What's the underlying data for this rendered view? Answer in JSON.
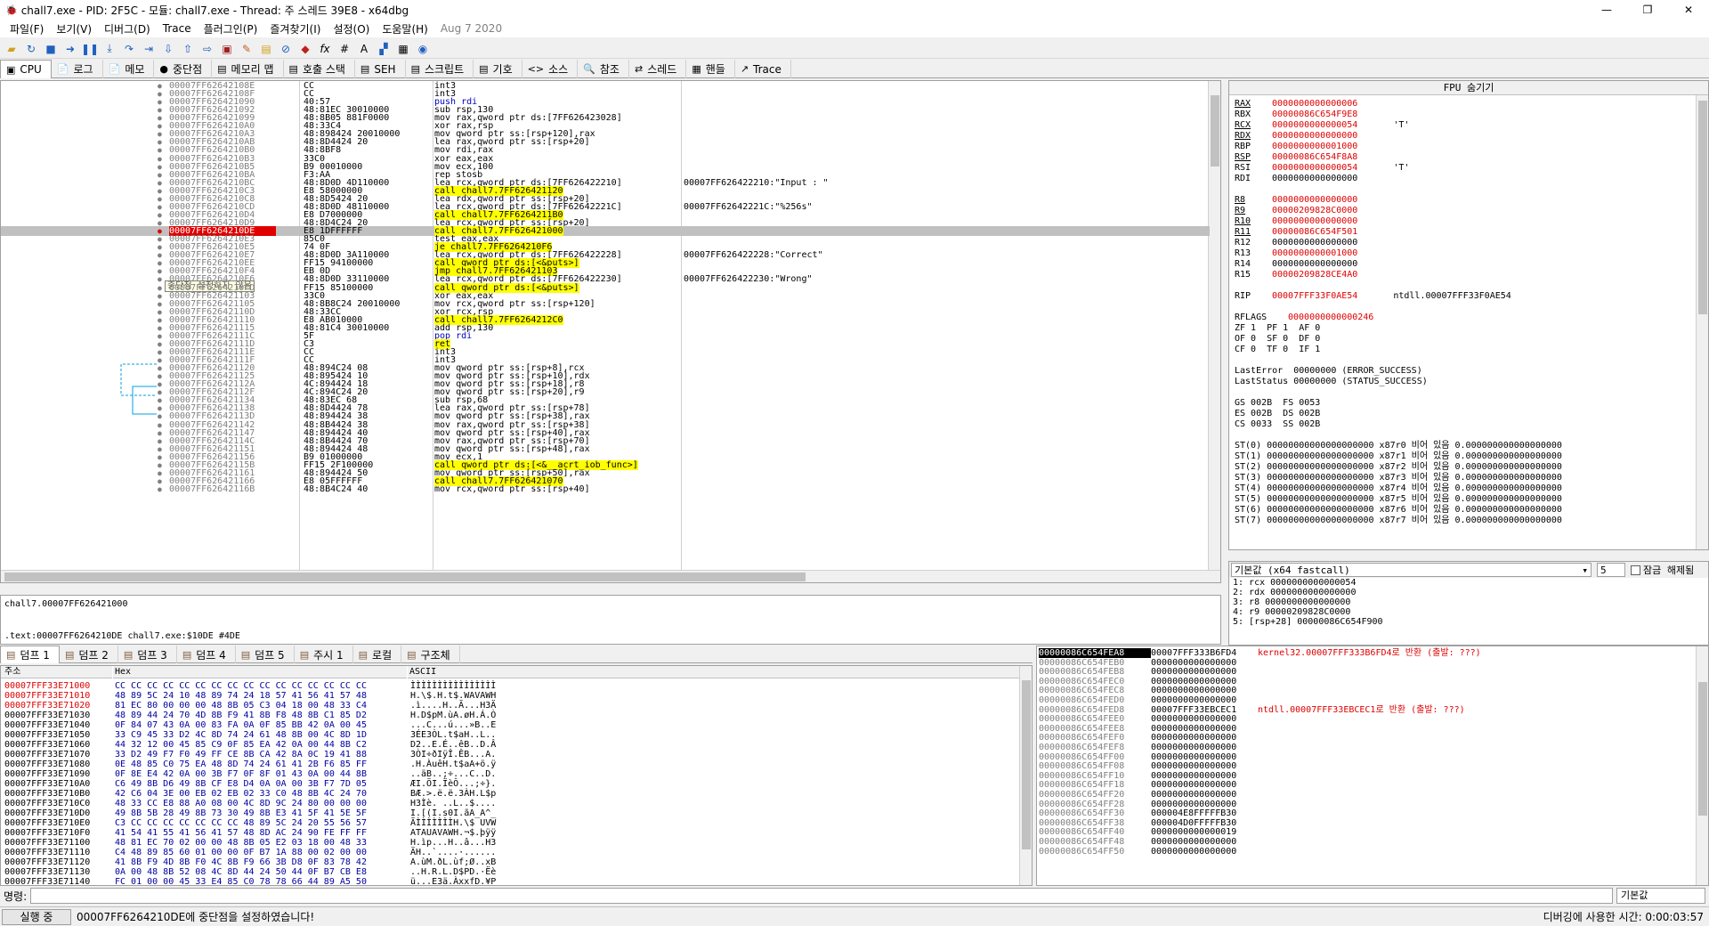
{
  "window": {
    "title": "chall7.exe - PID: 2F5C - 모듈: chall7.exe - Thread: 주 스레드 39E8 - x64dbg",
    "min": "—",
    "max": "❐",
    "close": "✕"
  },
  "menu": [
    "파일(F)",
    "보기(V)",
    "디버그(D)",
    "Trace",
    "플러그인(P)",
    "즐겨찾기(I)",
    "설정(O)",
    "도움말(H)"
  ],
  "menu_date": "Aug 7 2020",
  "tabs": [
    {
      "label": "CPU",
      "icon": "cpu-icon",
      "glyph": "▣"
    },
    {
      "label": "로그",
      "icon": "log-icon",
      "glyph": "📄"
    },
    {
      "label": "메모",
      "icon": "notes-icon",
      "glyph": "📄"
    },
    {
      "label": "중단점",
      "icon": "breakpoint-icon",
      "glyph": "●"
    },
    {
      "label": "메모리 맵",
      "icon": "memory-map-icon",
      "glyph": "▤"
    },
    {
      "label": "호출 스택",
      "icon": "call-stack-icon",
      "glyph": "▤"
    },
    {
      "label": "SEH",
      "icon": "seh-icon",
      "glyph": "▤"
    },
    {
      "label": "스크립트",
      "icon": "script-icon",
      "glyph": "▤"
    },
    {
      "label": "기호",
      "icon": "symbols-icon",
      "glyph": "▤"
    },
    {
      "label": "소스",
      "icon": "source-icon",
      "glyph": "<>"
    },
    {
      "label": "참조",
      "icon": "references-icon",
      "glyph": "🔍"
    },
    {
      "label": "스레드",
      "icon": "threads-icon",
      "glyph": "⇄"
    },
    {
      "label": "핸들",
      "icon": "handles-icon",
      "glyph": "▦"
    },
    {
      "label": "Trace",
      "icon": "trace-icon",
      "glyph": "↗"
    }
  ],
  "disasm": [
    {
      "addr": "00007FF62642108E",
      "bytes": "CC",
      "instr": "int3",
      "cmt": ""
    },
    {
      "addr": "00007FF62642108F",
      "bytes": "CC",
      "instr": "int3",
      "cmt": ""
    },
    {
      "addr": "00007FF626421090",
      "bytes": "40:57",
      "instr": "push rdi",
      "cmt": ""
    },
    {
      "addr": "00007FF626421092",
      "bytes": "48:81EC 30010000",
      "instr": "sub rsp,130",
      "cmt": ""
    },
    {
      "addr": "00007FF626421099",
      "bytes": "48:8B05 881F0000",
      "instr": "mov rax,qword ptr ds:[7FF626423028]",
      "cmt": ""
    },
    {
      "addr": "00007FF6264210A0",
      "bytes": "48:33C4",
      "instr": "xor rax,rsp",
      "cmt": ""
    },
    {
      "addr": "00007FF6264210A3",
      "bytes": "48:898424 20010000",
      "instr": "mov qword ptr ss:[rsp+120],rax",
      "cmt": ""
    },
    {
      "addr": "00007FF6264210AB",
      "bytes": "48:8D4424 20",
      "instr": "lea rax,qword ptr ss:[rsp+20]",
      "cmt": ""
    },
    {
      "addr": "00007FF6264210B0",
      "bytes": "48:8BF8",
      "instr": "mov rdi,rax",
      "cmt": ""
    },
    {
      "addr": "00007FF6264210B3",
      "bytes": "33C0",
      "instr": "xor eax,eax",
      "cmt": ""
    },
    {
      "addr": "00007FF6264210B5",
      "bytes": "B9 00010000",
      "instr": "mov ecx,100",
      "cmt": ""
    },
    {
      "addr": "00007FF6264210BA",
      "bytes": "F3:AA",
      "instr": "rep stosb",
      "cmt": ""
    },
    {
      "addr": "00007FF6264210BC",
      "bytes": "48:8D0D 4D110000",
      "instr": "lea rcx,qword ptr ds:[7FF626422210]",
      "cmt": "00007FF626422210:\"Input : \""
    },
    {
      "addr": "00007FF6264210C3",
      "bytes": "E8 58000000",
      "instr": "call chall7.7FF626421120",
      "cmt": ""
    },
    {
      "addr": "00007FF6264210C8",
      "bytes": "48:8D5424 20",
      "instr": "lea rdx,qword ptr ss:[rsp+20]",
      "cmt": ""
    },
    {
      "addr": "00007FF6264210CD",
      "bytes": "48:8D0D 48110000",
      "instr": "lea rcx,qword ptr ds:[7FF62642221C]",
      "cmt": "00007FF62642221C:\"%256s\""
    },
    {
      "addr": "00007FF6264210D4",
      "bytes": "E8 D7000000",
      "instr": "call chall7.7FF6264211B0",
      "cmt": ""
    },
    {
      "addr": "00007FF6264210D9",
      "bytes": "48:8D4C24 20",
      "instr": "lea rcx,qword ptr ss:[rsp+20]",
      "cmt": ""
    },
    {
      "addr": "00007FF6264210DE",
      "bytes": "E8 1DFFFFFF",
      "instr": "call chall7.7FF626421000",
      "cmt": ""
    },
    {
      "addr": "00007FF6264210E3",
      "bytes": "85C0",
      "instr": "test eax,eax",
      "cmt": ""
    },
    {
      "addr": "00007FF6264210E5",
      "bytes": "74 0F",
      "instr": "je chall7.7FF6264210F6",
      "cmt": ""
    },
    {
      "addr": "00007FF6264210E7",
      "bytes": "48:8D0D 3A110000",
      "instr": "lea rcx,qword ptr ds:[7FF626422228]",
      "cmt": "00007FF626422228:\"Correct\""
    },
    {
      "addr": "00007FF6264210EE",
      "bytes": "FF15 94100000",
      "instr": "call qword ptr ds:[<&puts>]",
      "cmt": ""
    },
    {
      "addr": "00007FF6264210F4",
      "bytes": "EB 0D",
      "instr": "jmp chall7.7FF626421103",
      "cmt": ""
    },
    {
      "addr": "00007FF6264210F6",
      "bytes": "48:8D0D 33110000",
      "instr": "lea rcx,qword ptr ds:[7FF626422230]",
      "cmt": "00007FF626422230:\"Wrong\""
    },
    {
      "addr": "00007FF6264210FD",
      "bytes": "FF15 85100000",
      "instr": "call qword ptr ds:[<&puts>]",
      "cmt": ""
    },
    {
      "addr": "00007FF626421103",
      "bytes": "33C0",
      "instr": "xor eax,eax",
      "cmt": ""
    },
    {
      "addr": "00007FF626421105",
      "bytes": "48:8B8C24 20010000",
      "instr": "mov rcx,qword ptr ss:[rsp+120]",
      "cmt": ""
    },
    {
      "addr": "00007FF62642110D",
      "bytes": "48:33CC",
      "instr": "xor rcx,rsp",
      "cmt": ""
    },
    {
      "addr": "00007FF626421110",
      "bytes": "E8 AB010000",
      "instr": "call chall7.7FF6264212C0",
      "cmt": ""
    },
    {
      "addr": "00007FF626421115",
      "bytes": "48:81C4 30010000",
      "instr": "add rsp,130",
      "cmt": ""
    },
    {
      "addr": "00007FF62642111C",
      "bytes": "5F",
      "instr": "pop rdi",
      "cmt": ""
    },
    {
      "addr": "00007FF62642111D",
      "bytes": "C3",
      "instr": "ret",
      "cmt": ""
    },
    {
      "addr": "00007FF62642111E",
      "bytes": "CC",
      "instr": "int3",
      "cmt": ""
    },
    {
      "addr": "00007FF62642111F",
      "bytes": "CC",
      "instr": "int3",
      "cmt": ""
    },
    {
      "addr": "00007FF626421120",
      "bytes": "48:894C24 08",
      "instr": "mov qword ptr ss:[rsp+8],rcx",
      "cmt": ""
    },
    {
      "addr": "00007FF626421125",
      "bytes": "48:895424 10",
      "instr": "mov qword ptr ss:[rsp+10],rdx",
      "cmt": ""
    },
    {
      "addr": "00007FF62642112A",
      "bytes": "4C:894424 18",
      "instr": "mov qword ptr ss:[rsp+18],r8",
      "cmt": ""
    },
    {
      "addr": "00007FF62642112F",
      "bytes": "4C:894C24 20",
      "instr": "mov qword ptr ss:[rsp+20],r9",
      "cmt": ""
    },
    {
      "addr": "00007FF626421134",
      "bytes": "48:83EC 68",
      "instr": "sub rsp,68",
      "cmt": ""
    },
    {
      "addr": "00007FF626421138",
      "bytes": "48:8D4424 78",
      "instr": "lea rax,qword ptr ss:[rsp+78]",
      "cmt": ""
    },
    {
      "addr": "00007FF62642113D",
      "bytes": "48:894424 38",
      "instr": "mov qword ptr ss:[rsp+38],rax",
      "cmt": ""
    },
    {
      "addr": "00007FF626421142",
      "bytes": "48:8B4424 38",
      "instr": "mov rax,qword ptr ss:[rsp+38]",
      "cmt": ""
    },
    {
      "addr": "00007FF626421147",
      "bytes": "48:894424 40",
      "instr": "mov qword ptr ss:[rsp+40],rax",
      "cmt": ""
    },
    {
      "addr": "00007FF62642114C",
      "bytes": "48:8B4424 70",
      "instr": "mov rax,qword ptr ss:[rsp+70]",
      "cmt": ""
    },
    {
      "addr": "00007FF626421151",
      "bytes": "48:894424 48",
      "instr": "mov qword ptr ss:[rsp+48],rax",
      "cmt": ""
    },
    {
      "addr": "00007FF626421156",
      "bytes": "B9 01000000",
      "instr": "mov ecx,1",
      "cmt": ""
    },
    {
      "addr": "00007FF62642115B",
      "bytes": "FF15 2F100000",
      "instr": "call qword ptr ds:[<&__acrt_iob_func>]",
      "cmt": ""
    },
    {
      "addr": "00007FF626421161",
      "bytes": "48:894424 50",
      "instr": "mov qword ptr ss:[rsp+50],rax",
      "cmt": ""
    },
    {
      "addr": "00007FF626421166",
      "bytes": "E8 05FFFFFF",
      "instr": "call chall7.7FF626421070",
      "cmt": ""
    },
    {
      "addr": "00007FF62642116B",
      "bytes": "48:8B4C24 40",
      "instr": "mov rcx,qword ptr ss:[rsp+40]",
      "cmt": ""
    }
  ],
  "tooltip": "중단점 설정하지 않음",
  "info_line1": "chall7.00007FF626421000",
  "info_line2": ".text:00007FF6264210DE chall7.exe:$10DE #4DE",
  "regs_title": "FPU 숨기기",
  "regs": [
    {
      "n": "RAX",
      "v": "0000000000000006",
      "x": ""
    },
    {
      "n": "RBX",
      "v": "00000086C654F9E8",
      "x": ""
    },
    {
      "n": "RCX",
      "v": "0000000000000054",
      "x": "'T'"
    },
    {
      "n": "RDX",
      "v": "0000000000000000",
      "x": ""
    },
    {
      "n": "RBP",
      "v": "0000000000001000",
      "x": ""
    },
    {
      "n": "RSP",
      "v": "00000086C654F8A8",
      "x": ""
    },
    {
      "n": "RSI",
      "v": "0000000000000054",
      "x": "'T'"
    },
    {
      "n": "RDI",
      "v": "0000000000000000",
      "x": ""
    },
    {
      "n": "",
      "v": "",
      "x": ""
    },
    {
      "n": "R8",
      "v": "0000000000000000",
      "x": ""
    },
    {
      "n": "R9",
      "v": "00000209828C0000",
      "x": ""
    },
    {
      "n": "R10",
      "v": "0000000000000000",
      "x": ""
    },
    {
      "n": "R11",
      "v": "00000086C654F501",
      "x": ""
    },
    {
      "n": "R12",
      "v": "0000000000000000",
      "x": ""
    },
    {
      "n": "R13",
      "v": "0000000000001000",
      "x": ""
    },
    {
      "n": "R14",
      "v": "0000000000000000",
      "x": ""
    },
    {
      "n": "R15",
      "v": "00000209828CE4A0",
      "x": ""
    },
    {
      "n": "",
      "v": "",
      "x": ""
    },
    {
      "n": "RIP",
      "v": "00007FFF33F0AE54",
      "x": "ntdll.00007FFF33F0AE54"
    }
  ],
  "rflags": {
    "label": "RFLAGS",
    "value": "0000000000000246"
  },
  "flags": [
    "ZF 1  PF 1  AF 0",
    "OF 0  SF 0  DF 0",
    "CF 0  TF 0  IF 1"
  ],
  "lasterr": [
    "LastError  00000000 (ERROR_SUCCESS)",
    "LastStatus 00000000 (STATUS_SUCCESS)"
  ],
  "segs": [
    "GS 002B  FS 0053",
    "ES 002B  DS 002B",
    "CS 0033  SS 002B"
  ],
  "st": [
    "ST(0) 00000000000000000000 x87r0 비어 있음 0.000000000000000000",
    "ST(1) 00000000000000000000 x87r1 비어 있음 0.000000000000000000",
    "ST(2) 00000000000000000000 x87r2 비어 있음 0.000000000000000000",
    "ST(3) 00000000000000000000 x87r3 비어 있음 0.000000000000000000",
    "ST(4) 00000000000000000000 x87r4 비어 있음 0.000000000000000000",
    "ST(5) 00000000000000000000 x87r5 비어 있음 0.000000000000000000",
    "ST(6) 00000000000000000000 x87r6 비어 있음 0.000000000000000000",
    "ST(7) 00000000000000000000 x87r7 비어 있음 0.000000000000000000"
  ],
  "cconv": {
    "select": "기본값 (x64 fastcall)",
    "count": "5",
    "lock": "잠금 해제됨"
  },
  "args": [
    "1: rcx 0000000000000054",
    "2: rdx 0000000000000000",
    "3: r8 0000000000000000",
    "4: r9 00000209828C0000",
    "5: [rsp+28] 00000086C654F900"
  ],
  "dump_tabs": [
    "덤프 1",
    "덤프 2",
    "덤프 3",
    "덤프 4",
    "덤프 5",
    "주시 1",
    "로컬",
    "구조체"
  ],
  "dump_hdr": {
    "addr": "주소",
    "hex": "Hex",
    "ascii": "ASCII"
  },
  "dump": [
    {
      "a": "00007FFF33E71000",
      "h": "CC CC CC CC CC CC CC CC CC CC CC CC CC CC CC CC",
      "s": "ÌÌÌÌÌÌÌÌÌÌÌÌÌÌÌÌ"
    },
    {
      "a": "00007FFF33E71010",
      "h": "48 89 5C 24 10 48 89 74 24 18 57 41 56 41 57 48",
      "s": "H.\\$.H.t$.WAVAWH"
    },
    {
      "a": "00007FFF33E71020",
      "h": "81 EC 80 00 00 00 48 8B 05 C3 04 18 00 48 33 C4",
      "s": ".ì....H..Ã...H3Ä"
    },
    {
      "a": "00007FFF33E71030",
      "h": "48 89 44 24 70 4D 8B F9 41 8B F8 48 8B C1 85 D2",
      "s": "H.D$pM.ùA.øH.Á.Ò"
    },
    {
      "a": "00007FFF33E71040",
      "h": "0F 84 07 43 0A 00 83 FA 0A 0F 85 BB 42 0A 00 45",
      "s": "...C...ú...»B..E"
    },
    {
      "a": "00007FFF33E71050",
      "h": "33 C9 45 33 D2 4C 8D 74 24 61 48 8B 00 4C 8D 1D",
      "s": "3ÉE3ÒL.t$aH..L.."
    },
    {
      "a": "00007FFF33E71060",
      "h": "44 32 12 00 45 85 C9 0F 85 EA 42 0A 00 44 8B C2",
      "s": "D2..E.É..êB..D.Â"
    },
    {
      "a": "00007FFF33E71070",
      "h": "33 D2 49 F7 F0 49 FF CE 8B CA 42 8A 0C 19 41 88",
      "s": "3ÒI÷ðIÿÎ.ÊB...A."
    },
    {
      "a": "00007FFF33E71080",
      "h": "0E 48 85 C0 75 EA 48 8D 74 24 61 41 2B F6 85 FF",
      "s": ".H.ÀuêH.t$aA+ö.ÿ"
    },
    {
      "a": "00007FFF33E71090",
      "h": "0F 8E E4 42 0A 00 3B F7 0F 8F 01 43 0A 00 44 8B",
      "s": "..äB..;÷...C..D."
    },
    {
      "a": "00007FFF33E710A0",
      "h": "C6 49 8B D6 49 8B CF E8 D4 0A 0A 00 3B F7 7D 05",
      "s": "ÆI.ÖI.ÏèÔ...;÷}."
    },
    {
      "a": "00007FFF33E710B0",
      "h": "42 C6 04 3E 00 EB 02 EB 02 33 C0 48 8B 4C 24 70",
      "s": "BÆ.>.ë.ë.3ÀH.L$p"
    },
    {
      "a": "00007FFF33E710C0",
      "h": "48 33 CC E8 88 A0 08 00 4C 8D 9C 24 80 00 00 00",
      "s": "H3Ìè. ..L..$...."
    },
    {
      "a": "00007FFF33E710D0",
      "h": "49 8B 5B 28 49 8B 73 30 49 8B E3 41 5F 41 5E 5F",
      "s": "I.[(I.s0I.ãA_A^_"
    },
    {
      "a": "00007FFF33E710E0",
      "h": "C3 CC CC CC CC CC CC CC 48 89 5C 24 20 55 56 57",
      "s": "ÃÌÌÌÌÌÌÌH.\\$ UVW"
    },
    {
      "a": "00007FFF33E710F0",
      "h": "41 54 41 55 41 56 41 57 48 8D AC 24 90 FE FF FF",
      "s": "ATAUAVAWH.¬$.þÿÿ"
    },
    {
      "a": "00007FFF33E71100",
      "h": "48 81 EC 70 02 00 00 48 8B 05 E2 03 18 00 48 33",
      "s": "H.ìp...H..â...H3"
    },
    {
      "a": "00007FFF33E71110",
      "h": "C4 48 89 85 60 01 00 00 0F B7 1A 88 00 02 00 00",
      "s": "ÄH..`....·......"
    },
    {
      "a": "00007FFF33E71120",
      "h": "41 8B F9 4D 8B F0 4C 8B F9 66 3B D8 0F 83 78 42",
      "s": "A.ùM.ðL.ùf;Ø..xB"
    },
    {
      "a": "00007FFF33E71130",
      "h": "0A 00 48 8B 52 08 4C 8D 44 24 50 44 0F B7 CB E8",
      "s": "..H.R.L.D$PD.·Ëè"
    },
    {
      "a": "00007FFF33E71140",
      "h": "FC 01 00 00 45 33 E4 85 C0 78 78 66 44 89 A5 50",
      "s": "ü...E3ä.ÀxxfD.¥P"
    }
  ],
  "stack": [
    {
      "a": "00000086C654FEA8",
      "v": "00007FFF333B6FD4",
      "c": "kernel32.00007FFF333B6FD4로 반환 (출발: ???)"
    },
    {
      "a": "00000086C654FEB0",
      "v": "0000000000000000",
      "c": ""
    },
    {
      "a": "00000086C654FEB8",
      "v": "0000000000000000",
      "c": ""
    },
    {
      "a": "00000086C654FEC0",
      "v": "0000000000000000",
      "c": ""
    },
    {
      "a": "00000086C654FEC8",
      "v": "0000000000000000",
      "c": ""
    },
    {
      "a": "00000086C654FED0",
      "v": "0000000000000000",
      "c": ""
    },
    {
      "a": "00000086C654FED8",
      "v": "00007FFF33EBCEC1",
      "c": "ntdll.00007FFF33EBCEC1로 반환 (출발: ???)"
    },
    {
      "a": "00000086C654FEE0",
      "v": "0000000000000000",
      "c": ""
    },
    {
      "a": "00000086C654FEE8",
      "v": "0000000000000000",
      "c": ""
    },
    {
      "a": "00000086C654FEF0",
      "v": "0000000000000000",
      "c": ""
    },
    {
      "a": "00000086C654FEF8",
      "v": "0000000000000000",
      "c": ""
    },
    {
      "a": "00000086C654FF00",
      "v": "0000000000000000",
      "c": ""
    },
    {
      "a": "00000086C654FF08",
      "v": "0000000000000000",
      "c": ""
    },
    {
      "a": "00000086C654FF10",
      "v": "0000000000000000",
      "c": ""
    },
    {
      "a": "00000086C654FF18",
      "v": "0000000000000000",
      "c": ""
    },
    {
      "a": "00000086C654FF20",
      "v": "0000000000000000",
      "c": ""
    },
    {
      "a": "00000086C654FF28",
      "v": "0000000000000000",
      "c": ""
    },
    {
      "a": "00000086C654FF30",
      "v": "000004E8FFFFFB30",
      "c": ""
    },
    {
      "a": "00000086C654FF38",
      "v": "000004D0FFFFFB30",
      "c": ""
    },
    {
      "a": "00000086C654FF40",
      "v": "0000000000000019",
      "c": ""
    },
    {
      "a": "00000086C654FF48",
      "v": "0000000000000000",
      "c": ""
    },
    {
      "a": "00000086C654FF50",
      "v": "0000000000000000",
      "c": ""
    }
  ],
  "cmd": {
    "label": "명령:",
    "select": "기본값"
  },
  "status": {
    "state": "실행 중",
    "msg": "00007FF6264210DE에 중단점을 설정하였습니다!",
    "time": "디버깅에 사용한 시간: 0:00:03:57"
  }
}
